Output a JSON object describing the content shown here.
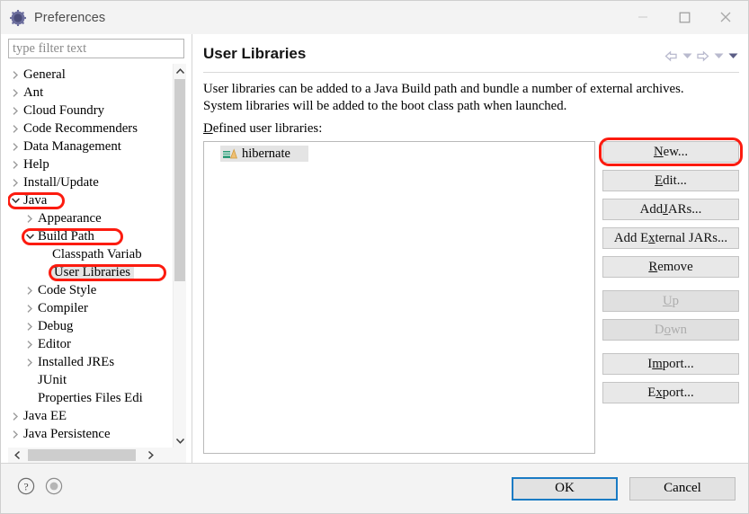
{
  "window": {
    "title": "Preferences",
    "icon": "preferences-gear-icon",
    "controls": {
      "minimize": "minimize-icon",
      "maximize": "maximize-icon",
      "close": "close-icon"
    }
  },
  "filter": {
    "placeholder": "type filter text",
    "value": ""
  },
  "tree": {
    "items": [
      {
        "label": "General",
        "indent": 0,
        "twisty": "collapsed",
        "selected": false,
        "highlight": false
      },
      {
        "label": "Ant",
        "indent": 0,
        "twisty": "collapsed",
        "selected": false,
        "highlight": false
      },
      {
        "label": "Cloud Foundry",
        "indent": 0,
        "twisty": "collapsed",
        "selected": false,
        "highlight": false
      },
      {
        "label": "Code Recommenders",
        "indent": 0,
        "twisty": "collapsed",
        "selected": false,
        "highlight": false
      },
      {
        "label": "Data Management",
        "indent": 0,
        "twisty": "collapsed",
        "selected": false,
        "highlight": false
      },
      {
        "label": "Help",
        "indent": 0,
        "twisty": "collapsed",
        "selected": false,
        "highlight": false
      },
      {
        "label": "Install/Update",
        "indent": 0,
        "twisty": "collapsed",
        "selected": false,
        "highlight": false
      },
      {
        "label": "Java",
        "indent": 0,
        "twisty": "expanded",
        "selected": false,
        "highlight": true
      },
      {
        "label": "Appearance",
        "indent": 1,
        "twisty": "collapsed",
        "selected": false,
        "highlight": false
      },
      {
        "label": "Build Path",
        "indent": 1,
        "twisty": "expanded",
        "selected": false,
        "highlight": true
      },
      {
        "label": "Classpath Variab",
        "indent": 2,
        "twisty": "none",
        "selected": false,
        "highlight": false
      },
      {
        "label": "User Libraries",
        "indent": 2,
        "twisty": "none",
        "selected": true,
        "highlight": true
      },
      {
        "label": "Code Style",
        "indent": 1,
        "twisty": "collapsed",
        "selected": false,
        "highlight": false
      },
      {
        "label": "Compiler",
        "indent": 1,
        "twisty": "collapsed",
        "selected": false,
        "highlight": false
      },
      {
        "label": "Debug",
        "indent": 1,
        "twisty": "collapsed",
        "selected": false,
        "highlight": false
      },
      {
        "label": "Editor",
        "indent": 1,
        "twisty": "collapsed",
        "selected": false,
        "highlight": false
      },
      {
        "label": "Installed JREs",
        "indent": 1,
        "twisty": "collapsed",
        "selected": false,
        "highlight": false
      },
      {
        "label": "JUnit",
        "indent": 1,
        "twisty": "none",
        "selected": false,
        "highlight": false
      },
      {
        "label": "Properties Files Edi",
        "indent": 1,
        "twisty": "none",
        "selected": false,
        "highlight": false
      },
      {
        "label": "Java EE",
        "indent": 0,
        "twisty": "collapsed",
        "selected": false,
        "highlight": false
      },
      {
        "label": "Java Persistence",
        "indent": 0,
        "twisty": "collapsed",
        "selected": false,
        "highlight": false
      }
    ]
  },
  "page": {
    "title": "User Libraries",
    "description": "User libraries can be added to a Java Build path and bundle a number of external archives. System libraries will be added to the boot class path when launched.",
    "defined_label_mnemonic": "D",
    "defined_label_rest": "efined user libraries:",
    "nav": {
      "back": "back-arrow-icon",
      "back_menu": "chevron-down-icon",
      "forward": "forward-arrow-icon",
      "forward_menu": "chevron-down-icon",
      "more_menu": "chevron-down-icon"
    }
  },
  "library_list": {
    "items": [
      {
        "name": "hibernate",
        "icon": "library-books-icon",
        "selected": true
      }
    ]
  },
  "buttons": [
    {
      "name": "new",
      "mnemonic": "N",
      "before": "",
      "after": "ew...",
      "disabled": false,
      "highlight": true
    },
    {
      "name": "edit",
      "mnemonic": "E",
      "before": "",
      "after": "dit...",
      "disabled": false,
      "highlight": false
    },
    {
      "name": "add-jars",
      "mnemonic": "J",
      "before": "Add ",
      "after": "ARs...",
      "disabled": false,
      "highlight": false
    },
    {
      "name": "add-external-jars",
      "mnemonic": "x",
      "before": "Add E",
      "after": "ternal JARs...",
      "disabled": false,
      "highlight": false
    },
    {
      "name": "remove",
      "mnemonic": "R",
      "before": "",
      "after": "emove",
      "disabled": false,
      "highlight": false
    },
    {
      "name": "up",
      "mnemonic": "U",
      "before": "",
      "after": "p",
      "disabled": true,
      "highlight": false
    },
    {
      "name": "down",
      "mnemonic": "o",
      "before": "D",
      "after": "wn",
      "disabled": true,
      "highlight": false
    },
    {
      "name": "import",
      "mnemonic": "m",
      "before": "I",
      "after": "port...",
      "disabled": false,
      "highlight": false
    },
    {
      "name": "export",
      "mnemonic": "x",
      "before": "E",
      "after": "port...",
      "disabled": false,
      "highlight": false
    }
  ],
  "footer": {
    "help_icon": "help-question-icon",
    "about_icon": "info-circle-icon",
    "ok_label": "OK",
    "cancel_label": "Cancel"
  },
  "colors": {
    "highlight_red": "#fc1b0f",
    "focus_blue": "#1a7bc4",
    "selection_gray": "#e4e4e4",
    "window_bg": "#f3f3f3"
  }
}
